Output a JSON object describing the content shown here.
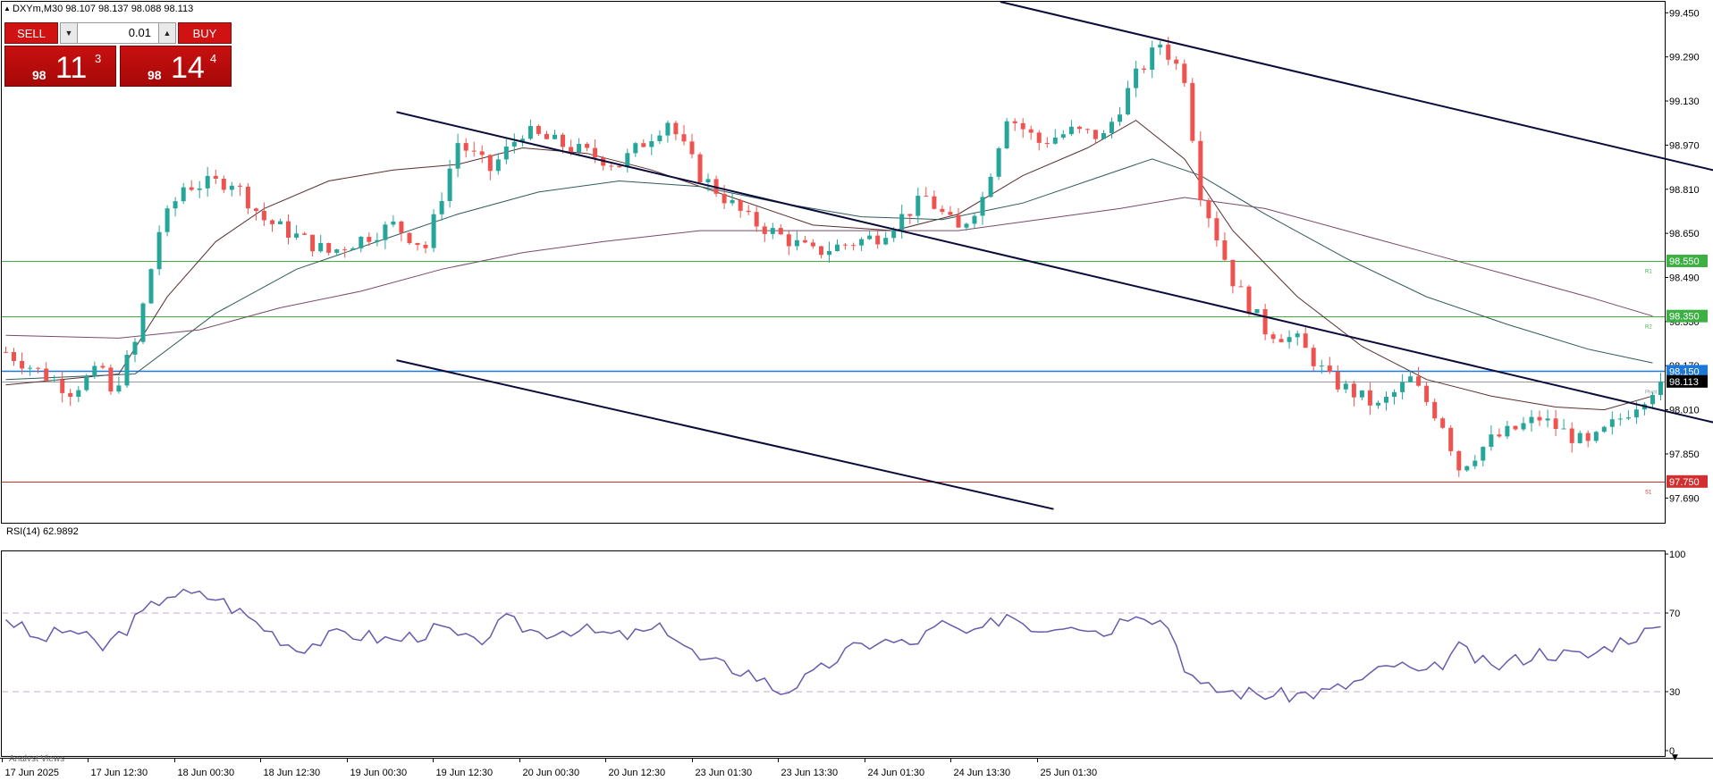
{
  "header": {
    "symbol_info": "DXYm,M30  98.107 98.137 98.088 98.113"
  },
  "trade_panel": {
    "sell_label": "SELL",
    "buy_label": "BUY",
    "lot": "0.01",
    "sell_price": {
      "prefix": "98",
      "big": "11",
      "sup": "3"
    },
    "buy_price": {
      "prefix": "98",
      "big": "14",
      "sup": "4"
    }
  },
  "rsi_label": "RSI(14) 62.9892",
  "bottom_tab_label": "Analyst Views",
  "colors": {
    "bull": "#26a69a",
    "bear": "#ef5350",
    "resistance": "#3cb043",
    "support": "#d03030",
    "pivot": "#1e78d8",
    "current": "#555555",
    "channel": "#0b0b3b",
    "rsi": "#6a5aad",
    "ma_fast": "#5a2f2f",
    "ma_mid": "#2f5a5a",
    "ma_slow": "#7a4a6a"
  },
  "chart_data": [
    {
      "type": "candlestick",
      "title": "DXYm,M30",
      "ylim": [
        97.61,
        99.49
      ],
      "y_ticks": [
        "99.450",
        "99.290",
        "99.130",
        "98.970",
        "98.810",
        "98.650",
        "98.490",
        "98.330",
        "98.170",
        "98.010",
        "97.850",
        "97.690"
      ],
      "x_tick_labels": [
        "17 Jun 2025",
        "17 Jun 12:30",
        "18 Jun 00:30",
        "18 Jun 12:30",
        "19 Jun 00:30",
        "19 Jun 12:30",
        "20 Jun 00:30",
        "20 Jun 12:30",
        "23 Jun 01:30",
        "23 Jun 13:30",
        "24 Jun 01:30",
        "24 Jun 13:30",
        "25 Jun 01:30"
      ],
      "waypoints": [
        [
          0,
          98.22
        ],
        [
          8,
          98.08
        ],
        [
          12,
          98.16
        ],
        [
          13,
          98.06
        ],
        [
          16,
          98.25
        ],
        [
          19,
          98.66
        ],
        [
          22,
          98.82
        ],
        [
          28,
          98.84
        ],
        [
          32,
          98.7
        ],
        [
          40,
          98.58
        ],
        [
          48,
          98.68
        ],
        [
          52,
          98.6
        ],
        [
          56,
          98.98
        ],
        [
          60,
          98.88
        ],
        [
          64,
          99.02
        ],
        [
          70,
          98.96
        ],
        [
          76,
          98.9
        ],
        [
          82,
          99.06
        ],
        [
          86,
          98.86
        ],
        [
          92,
          98.7
        ],
        [
          100,
          98.58
        ],
        [
          108,
          98.64
        ],
        [
          114,
          98.78
        ],
        [
          118,
          98.66
        ],
        [
          121,
          98.78
        ],
        [
          124,
          99.08
        ],
        [
          128,
          98.98
        ],
        [
          132,
          99.02
        ],
        [
          136,
          99.0
        ],
        [
          140,
          99.22
        ],
        [
          143,
          99.34
        ],
        [
          146,
          99.22
        ],
        [
          148,
          98.8
        ],
        [
          152,
          98.48
        ],
        [
          156,
          98.3
        ],
        [
          160,
          98.26
        ],
        [
          164,
          98.12
        ],
        [
          170,
          98.02
        ],
        [
          174,
          98.12
        ],
        [
          178,
          97.96
        ],
        [
          180,
          97.8
        ],
        [
          184,
          97.9
        ],
        [
          190,
          97.98
        ],
        [
          196,
          97.88
        ],
        [
          200,
          97.98
        ],
        [
          203,
          98.06
        ],
        [
          205,
          98.113
        ]
      ],
      "ma_fast": [
        [
          0,
          98.1
        ],
        [
          14,
          98.14
        ],
        [
          20,
          98.42
        ],
        [
          26,
          98.62
        ],
        [
          32,
          98.74
        ],
        [
          40,
          98.84
        ],
        [
          48,
          98.88
        ],
        [
          56,
          98.9
        ],
        [
          64,
          98.96
        ],
        [
          72,
          98.94
        ],
        [
          80,
          98.88
        ],
        [
          90,
          98.78
        ],
        [
          100,
          98.68
        ],
        [
          110,
          98.66
        ],
        [
          118,
          98.72
        ],
        [
          126,
          98.86
        ],
        [
          134,
          98.96
        ],
        [
          140,
          99.06
        ],
        [
          146,
          98.92
        ],
        [
          152,
          98.66
        ],
        [
          160,
          98.42
        ],
        [
          168,
          98.24
        ],
        [
          176,
          98.12
        ],
        [
          184,
          98.06
        ],
        [
          192,
          98.02
        ],
        [
          198,
          98.01
        ],
        [
          204,
          98.06
        ]
      ],
      "ma_mid": [
        [
          0,
          98.12
        ],
        [
          16,
          98.14
        ],
        [
          26,
          98.36
        ],
        [
          36,
          98.52
        ],
        [
          46,
          98.62
        ],
        [
          56,
          98.72
        ],
        [
          66,
          98.8
        ],
        [
          76,
          98.84
        ],
        [
          86,
          98.82
        ],
        [
          96,
          98.76
        ],
        [
          106,
          98.71
        ],
        [
          116,
          98.7
        ],
        [
          126,
          98.76
        ],
        [
          136,
          98.86
        ],
        [
          142,
          98.92
        ],
        [
          148,
          98.86
        ],
        [
          156,
          98.72
        ],
        [
          166,
          98.56
        ],
        [
          176,
          98.42
        ],
        [
          186,
          98.32
        ],
        [
          196,
          98.23
        ],
        [
          204,
          98.18
        ]
      ],
      "ma_slow": [
        [
          0,
          98.28
        ],
        [
          14,
          98.27
        ],
        [
          24,
          98.3
        ],
        [
          34,
          98.38
        ],
        [
          44,
          98.44
        ],
        [
          54,
          98.52
        ],
        [
          64,
          98.58
        ],
        [
          74,
          98.62
        ],
        [
          86,
          98.66
        ],
        [
          96,
          98.66
        ],
        [
          108,
          98.66
        ],
        [
          118,
          98.66
        ],
        [
          128,
          98.7
        ],
        [
          138,
          98.74
        ],
        [
          146,
          98.78
        ],
        [
          156,
          98.74
        ],
        [
          166,
          98.66
        ],
        [
          176,
          98.58
        ],
        [
          186,
          98.5
        ],
        [
          196,
          98.42
        ],
        [
          204,
          98.35
        ]
      ],
      "horizontal_lines": [
        {
          "name": "resistance-2",
          "value": 98.55,
          "label": "98.550",
          "tag": "R1"
        },
        {
          "name": "resistance-1",
          "value": 98.35,
          "label": "98.350",
          "tag": "R2"
        },
        {
          "name": "pivot",
          "value": 98.15,
          "label": "98.150",
          "tag": ""
        },
        {
          "name": "current-price",
          "value": 98.113,
          "label": "98.113",
          "tag": "Pivot"
        },
        {
          "name": "support",
          "value": 97.75,
          "label": "97.750",
          "tag": "S1"
        }
      ],
      "channel_lines": [
        {
          "from": [
            123.2,
            99.49
          ],
          "to": [
            311.2,
            98.19
          ]
        },
        {
          "from": [
            48.4,
            99.09
          ],
          "to": [
            257.1,
            97.65
          ]
        },
        {
          "from": [
            48.4,
            98.19
          ],
          "to": [
            129.8,
            97.65
          ]
        }
      ]
    },
    {
      "type": "line",
      "title": "RSI(14) 62.9892",
      "ylim": [
        0,
        100
      ],
      "y_ticks": [
        "100",
        "70",
        "30",
        "0"
      ],
      "levels": [
        70,
        30
      ],
      "waypoints": [
        [
          0,
          68
        ],
        [
          4,
          56
        ],
        [
          8,
          62
        ],
        [
          12,
          52
        ],
        [
          16,
          66
        ],
        [
          20,
          80
        ],
        [
          26,
          78
        ],
        [
          30,
          68
        ],
        [
          36,
          52
        ],
        [
          42,
          60
        ],
        [
          48,
          56
        ],
        [
          54,
          62
        ],
        [
          58,
          54
        ],
        [
          62,
          66
        ],
        [
          66,
          60
        ],
        [
          70,
          62
        ],
        [
          76,
          58
        ],
        [
          82,
          62
        ],
        [
          86,
          46
        ],
        [
          92,
          40
        ],
        [
          96,
          30
        ],
        [
          100,
          38
        ],
        [
          104,
          50
        ],
        [
          108,
          56
        ],
        [
          112,
          54
        ],
        [
          116,
          64
        ],
        [
          120,
          58
        ],
        [
          124,
          70
        ],
        [
          128,
          62
        ],
        [
          132,
          66
        ],
        [
          136,
          60
        ],
        [
          140,
          72
        ],
        [
          144,
          64
        ],
        [
          146,
          44
        ],
        [
          148,
          32
        ],
        [
          152,
          30
        ],
        [
          158,
          28
        ],
        [
          164,
          30
        ],
        [
          168,
          36
        ],
        [
          172,
          44
        ],
        [
          176,
          38
        ],
        [
          180,
          52
        ],
        [
          184,
          42
        ],
        [
          190,
          50
        ],
        [
          196,
          48
        ],
        [
          200,
          56
        ],
        [
          205,
          63
        ]
      ]
    }
  ]
}
